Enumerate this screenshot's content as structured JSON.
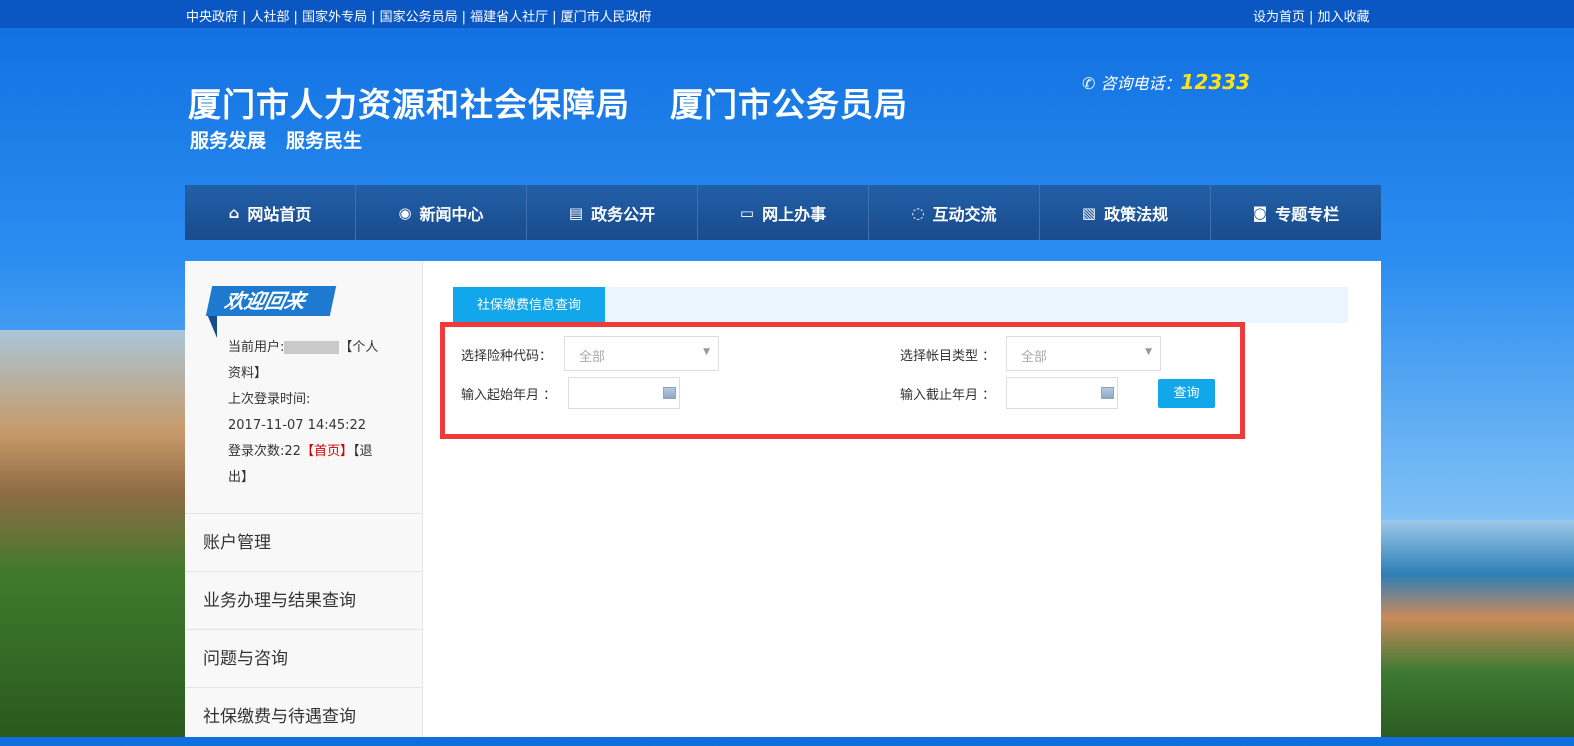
{
  "topbar": {
    "links": [
      "中央政府",
      "人社部",
      "国家外专局",
      "国家公务员局",
      "福建省人社厅",
      "厦门市人民政府"
    ],
    "right": [
      "设为首页",
      "加入收藏"
    ]
  },
  "header": {
    "titles": [
      "厦门市人力资源和社会保障局",
      "厦门市公务员局"
    ],
    "slogans": [
      "服务发展",
      "服务民生"
    ],
    "phone_label": "咨询电话：",
    "phone": "12333"
  },
  "nav": [
    {
      "label": "网站首页",
      "icon": "home-icon",
      "glyph": "⌂"
    },
    {
      "label": "新闻中心",
      "icon": "news-icon",
      "glyph": "◉"
    },
    {
      "label": "政务公开",
      "icon": "document-icon",
      "glyph": "▤"
    },
    {
      "label": "网上办事",
      "icon": "monitor-icon",
      "glyph": "▭"
    },
    {
      "label": "互动交流",
      "icon": "chat-icon",
      "glyph": "◌"
    },
    {
      "label": "政策法规",
      "icon": "policy-icon",
      "glyph": "▧"
    },
    {
      "label": "专题专栏",
      "icon": "topic-icon",
      "glyph": "◙"
    }
  ],
  "sidebar": {
    "welcome": "欢迎回来",
    "user_label": "当前用户:",
    "profile_link": "【个人资料】",
    "last_login_label": "上次登录时间:",
    "last_login": "2017-11-07 14:45:22",
    "login_count_label": "登录次数:22",
    "home_link": "【首页】",
    "logout_link": "【退出】",
    "menu": [
      "账户管理",
      "业务办理与结果查询",
      "问题与咨询",
      "社保缴费与待遇查询"
    ]
  },
  "main": {
    "tab": "社保缴费信息查询",
    "insurance_label": "选择险种代码：",
    "insurance_value": "全部",
    "account_label": "选择帐目类型 ：",
    "account_value": "全部",
    "start_label": "输入起始年月 ：",
    "end_label": "输入截止年月 ：",
    "query_button": "查询"
  }
}
